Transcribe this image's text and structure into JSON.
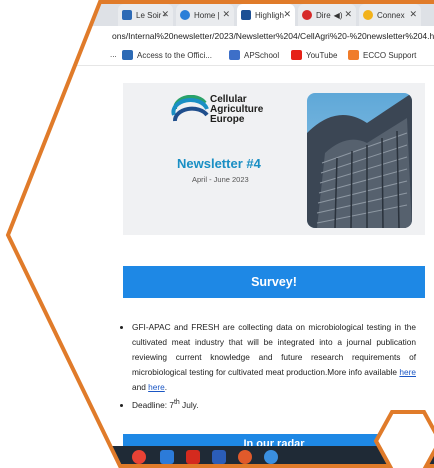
{
  "browser": {
    "tabs": [
      {
        "label": "Le Soir -",
        "color": "#2d6ab5"
      },
      {
        "label": "Home |",
        "color": "#2b7fd8"
      },
      {
        "label": "Highligh",
        "color": "#1c4f94"
      },
      {
        "label": "Dire",
        "color": "#d62a2a"
      },
      {
        "label": "Connex",
        "color": "#f2b21b"
      }
    ],
    "url": "ons/Internal%20newsletter/2023/Newsletter%204/CellAgri%20-%20newsletter%204.html",
    "bookmarks": [
      {
        "label": "Access to the Offici...",
        "color": "#2d6ab5"
      },
      {
        "label": "APSchool",
        "color": "#3d6fc8"
      },
      {
        "label": "YouTube",
        "color": "#e62117"
      },
      {
        "label": "ECCO Support",
        "color": "#f07c2a"
      }
    ]
  },
  "newsletter": {
    "brand_line1": "Cellular",
    "brand_line2": "Agriculture",
    "brand_line3": "Europe",
    "title": "Newsletter #4",
    "date": "April - June 2023"
  },
  "survey": {
    "heading": "Survey!",
    "bullet1_text": "GFI-APAC and FRESH are collecting data on microbiological testing in the cultivated meat industry that will be integrated into a journal publication reviewing current knowledge and future research requirements of microbiological testing for cultivated meat production.More info available ",
    "link1": "here ",
    "and": "and ",
    "link2": "here",
    "period": ".",
    "deadline_prefix": "Deadline: 7",
    "deadline_sup": "th",
    "deadline_suffix": " July."
  },
  "next_section": {
    "heading": "In our radar"
  },
  "taskbar": {
    "icons": [
      {
        "name": "chrome-icon",
        "color": "#e94235"
      },
      {
        "name": "app-icon",
        "color": "#2c7bd9"
      },
      {
        "name": "pdf-icon",
        "color": "#d42a1e"
      },
      {
        "name": "word-icon",
        "color": "#2b5db8"
      },
      {
        "name": "powerpoint-icon",
        "color": "#e05a2b"
      },
      {
        "name": "teams-icon",
        "color": "#3a8fe0"
      }
    ]
  },
  "colors": {
    "accent": "#1e88e5",
    "hexagon_outline": "#e07b2a",
    "title_blue": "#1a8fc4"
  }
}
